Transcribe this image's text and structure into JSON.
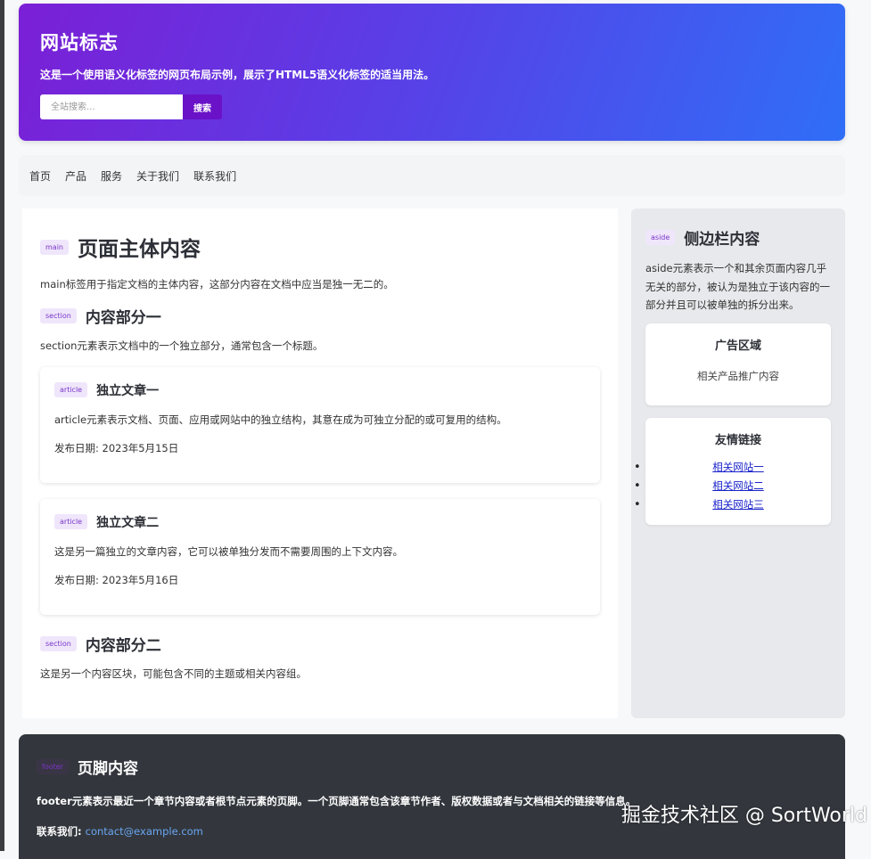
{
  "header": {
    "logo": "网站标志",
    "description": "这是一个使用语义化标签的网页布局示例，展示了HTML5语义化标签的适当用法。",
    "search_placeholder": "全站搜索...",
    "search_button": "搜索"
  },
  "nav": {
    "items": [
      "首页",
      "产品",
      "服务",
      "关于我们",
      "联系我们"
    ]
  },
  "main": {
    "tag": "main",
    "title": "页面主体内容",
    "description": "main标签用于指定文档的主体内容，这部分内容在文档中应当是独一无二的。",
    "sections": [
      {
        "tag": "section",
        "title": "内容部分一",
        "description": "section元素表示文档中的一个独立部分，通常包含一个标题。",
        "articles": [
          {
            "tag": "article",
            "title": "独立文章一",
            "text": "article元素表示文档、页面、应用或网站中的独立结构，其意在成为可独立分配的或可复用的结构。",
            "date": "发布日期: 2023年5月15日"
          },
          {
            "tag": "article",
            "title": "独立文章二",
            "text": "这是另一篇独立的文章内容，它可以被单独分发而不需要周围的上下文内容。",
            "date": "发布日期: 2023年5月16日"
          }
        ]
      },
      {
        "tag": "section",
        "title": "内容部分二",
        "description": "这是另一个内容区块，可能包含不同的主题或相关内容组。"
      }
    ]
  },
  "aside": {
    "tag": "aside",
    "title": "侧边栏内容",
    "description": "aside元素表示一个和其余页面内容几乎无关的部分，被认为是独立于该内容的一部分并且可以被单独的拆分出来。",
    "ad_title": "广告区域",
    "ad_text": "相关产品推广内容",
    "links_title": "友情链接",
    "links": [
      "相关网站一",
      "相关网站二",
      "相关网站三"
    ]
  },
  "footer": {
    "tag": "footer",
    "title": "页脚内容",
    "description": "footer元素表示最近一个章节内容或者根节点元素的页脚。一个页脚通常包含该章节作者、版权数据或者与文档相关的链接等信息。",
    "contact_label": "联系我们:",
    "contact_email": "contact@example.com"
  },
  "watermark": "掘金技术社区 @ SortWorld",
  "colors": {
    "header_start": "#7b1fd6",
    "header_end": "#2f6ef7",
    "search_button": "#6a12c8",
    "footer_bg": "#33373d",
    "tag_text": "#7a35c8",
    "link": "#1a23c9"
  }
}
